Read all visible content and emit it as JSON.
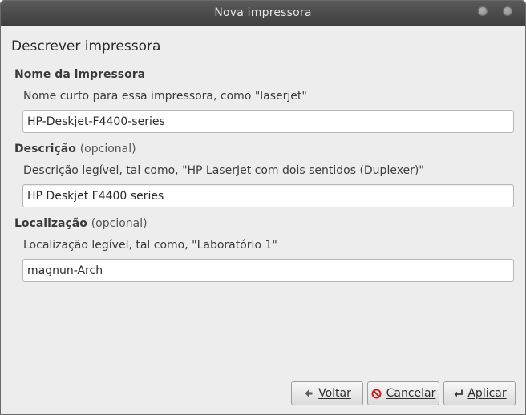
{
  "window": {
    "title": "Nova impressora"
  },
  "page": {
    "heading": "Descrever impressora"
  },
  "name_section": {
    "title": "Nome da impressora",
    "hint": "Nome curto para essa impressora, como \"laserjet\"",
    "value": "HP-Deskjet-F4400-series"
  },
  "description_section": {
    "title": "Descrição",
    "optional": "(opcional)",
    "hint": "Descrição legível, tal como, \"HP LaserJet com dois sentidos (Duplexer)\"",
    "value": "HP Deskjet F4400 series"
  },
  "location_section": {
    "title": "Localização",
    "optional": "(opcional)",
    "hint": "Localização legível, tal como, \"Laboratório 1\"",
    "value": "magnun-Arch"
  },
  "buttons": {
    "back": {
      "label": "Voltar",
      "icon": "arrow-left-icon"
    },
    "cancel": {
      "label": "Cancelar",
      "icon": "cancel-icon"
    },
    "apply": {
      "label": "Aplicar",
      "icon": "enter-icon"
    }
  },
  "colors": {
    "titlebar": "#4a4a4a",
    "background": "#ededed",
    "cancel_icon": "#cc1f1f"
  }
}
